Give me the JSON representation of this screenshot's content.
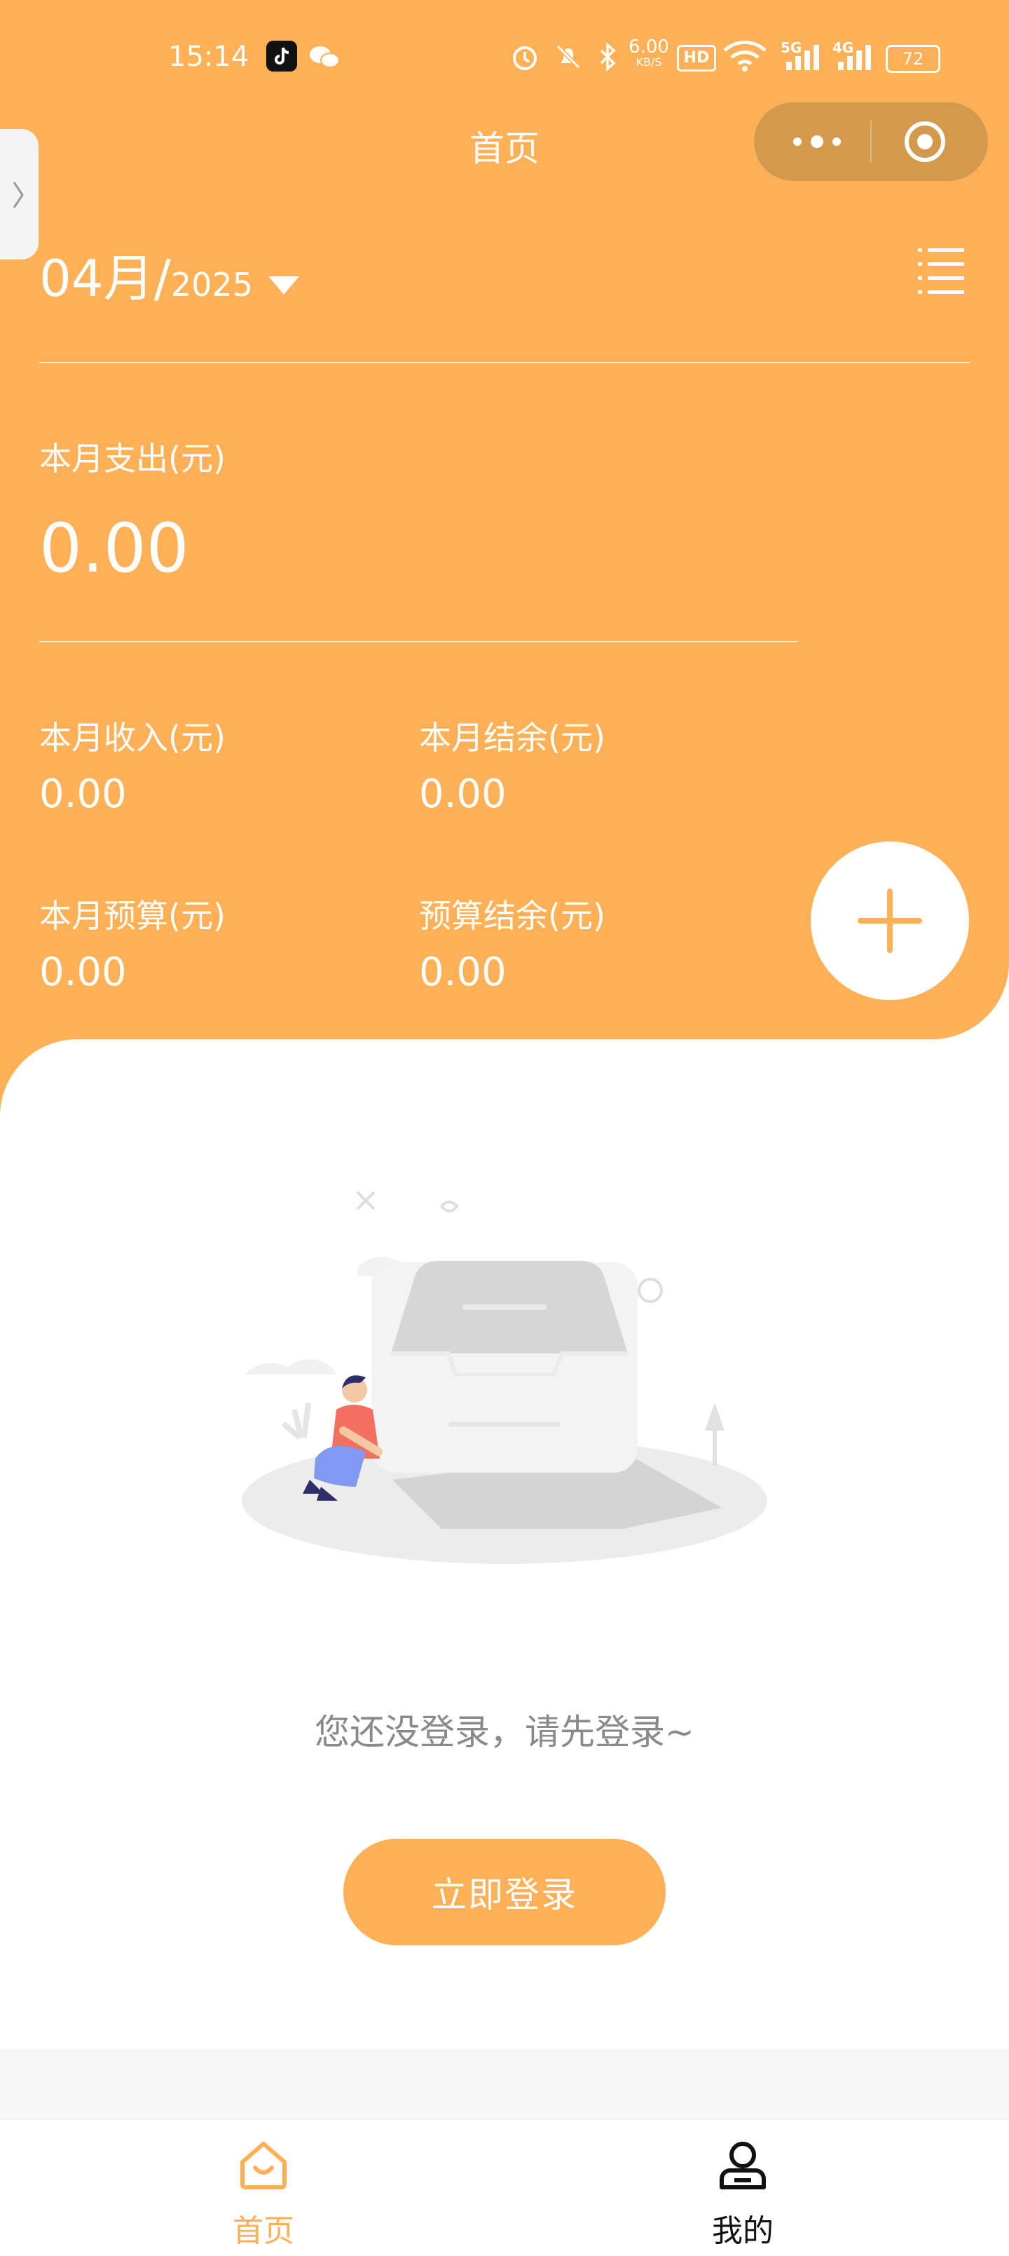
{
  "status_bar": {
    "time": "15:14",
    "net_speed": "6.00",
    "net_unit": "KB/S",
    "hd": "HD",
    "sig1": "5G",
    "sig2": "4G",
    "battery": "72"
  },
  "nav": {
    "title": "首页"
  },
  "date": {
    "month": "04月/",
    "year": "2025"
  },
  "summary": {
    "expense_label": "本月支出(元)",
    "expense_value": "0.00",
    "income_label": "本月收入(元)",
    "income_value": "0.00",
    "balance_label": "本月结余(元)",
    "balance_value": "0.00",
    "budget_label": "本月预算(元)",
    "budget_value": "0.00",
    "budget_balance_label": "预算结余(元)",
    "budget_balance_value": "0.00"
  },
  "empty": {
    "message": "您还没登录，请先登录~",
    "button": "立即登录"
  },
  "tabbar": {
    "home": "首页",
    "mine": "我的"
  },
  "colors": {
    "accent": "#fdb055"
  }
}
